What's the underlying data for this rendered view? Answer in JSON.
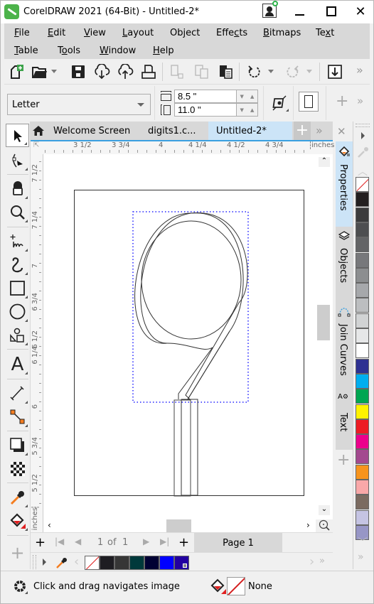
{
  "window": {
    "title": "CorelDRAW 2021 (64-Bit) - Untitled-2*",
    "minimize_glyph": "—",
    "maximize_glyph": "☐",
    "close_glyph": "✕"
  },
  "menu": {
    "items": [
      {
        "label": "File",
        "accel": "F"
      },
      {
        "label": "Edit",
        "accel": "E"
      },
      {
        "label": "View",
        "accel": "V"
      },
      {
        "label": "Layout",
        "accel": "L"
      },
      {
        "label": "Object",
        "accel": "j"
      },
      {
        "label": "Effects",
        "accel": "c"
      },
      {
        "label": "Bitmaps",
        "accel": "B"
      },
      {
        "label": "Text",
        "accel": "x"
      },
      {
        "label": "Table",
        "accel": "T"
      },
      {
        "label": "Tools",
        "accel": "o"
      },
      {
        "label": "Window",
        "accel": "W"
      },
      {
        "label": "Help",
        "accel": "H"
      }
    ]
  },
  "toolbar": {
    "buttons": [
      "new-document",
      "open",
      "save",
      "import-cloud",
      "export-cloud",
      "print",
      "copy-properties",
      "copy",
      "paste",
      "undo",
      "redo",
      "import"
    ],
    "overflow_glyph": "»"
  },
  "property_bar": {
    "page_size": "Letter",
    "width": "8.5 \"",
    "height": "11.0 \"",
    "add_glyph": "+",
    "overflow_glyph": "»"
  },
  "tabs": {
    "items": [
      {
        "label": "Welcome Screen",
        "active": false
      },
      {
        "label": "digits1.c...",
        "active": false
      },
      {
        "label": "Untitled-2*",
        "active": true
      }
    ],
    "add_glyph": "+",
    "overflow_glyph": "»"
  },
  "rulers": {
    "unit": "inches",
    "horizontal": [
      "3 1/2",
      "3 3/4",
      "4",
      "4 1/4",
      "4 1/2",
      "4 3/4"
    ],
    "vertical": [
      "7 1/2",
      "7 1/4",
      "7",
      "6 3/4",
      "6 1/2",
      "6 1/4",
      "6",
      "5 3/4",
      "5 1/2"
    ]
  },
  "page_nav": {
    "current": "1",
    "of_label": "of",
    "total": "1",
    "page_tab": "Page 1",
    "add_glyph": "+"
  },
  "dockers": {
    "tabs": [
      {
        "label": "Properties",
        "active": true
      },
      {
        "label": "Objects",
        "active": false
      },
      {
        "label": "Join Curves",
        "active": false
      },
      {
        "label": "Text",
        "active": false
      }
    ],
    "close_glyph": "✕",
    "add_glyph": "+"
  },
  "palette": {
    "colors": [
      "none",
      "#231f20",
      "#3b3b3c",
      "#4d4e50",
      "#636466",
      "#77787b",
      "#8c8e90",
      "#a6a8ab",
      "#bcbec0",
      "#d1d3d4",
      "#e6e7e8",
      "#ffffff",
      "#2e3192",
      "#00aeef",
      "#00a651",
      "#fff200",
      "#ed1c24",
      "#ec008c",
      "#a3498f",
      "#f7941d",
      "#f9a8a9",
      "#7b6b61",
      "#c5c4e3",
      "#9796c6"
    ]
  },
  "document_palette": {
    "colors": [
      "none",
      "#1e1d22",
      "#363636",
      "#00393b",
      "#000033",
      "#0000ff",
      "#2200a0"
    ]
  },
  "status": {
    "message": "Click and drag navigates image",
    "fill_label": "None"
  },
  "accent": {
    "selection": "#2323ff",
    "active_tab": "#cce4f7",
    "ruler_line": "#3aa0e0"
  }
}
